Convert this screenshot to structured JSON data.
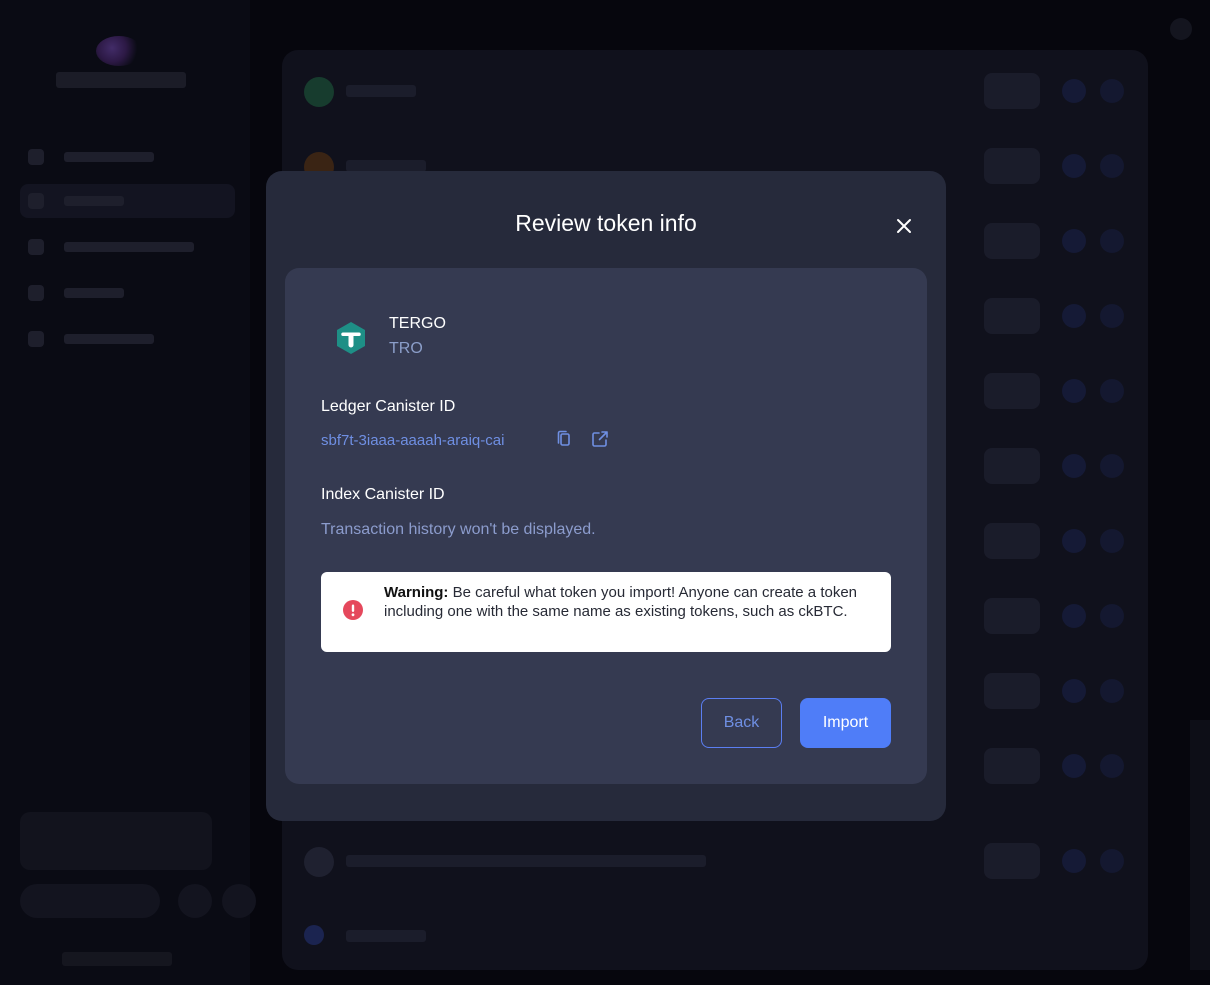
{
  "modal": {
    "title": "Review token info",
    "close_icon": "close-icon"
  },
  "token": {
    "name": "TERGO",
    "symbol": "TRO",
    "logo_icon": "tergo-logo-icon",
    "logo_color": "#1e8f86"
  },
  "ledger": {
    "label": "Ledger Canister ID",
    "value": "sbf7t-3iaaa-aaaah-araiq-cai",
    "copy_icon": "copy-icon",
    "external_icon": "external-link-icon"
  },
  "index": {
    "label": "Index Canister ID",
    "message": "Transaction history won't be displayed."
  },
  "warning": {
    "title": "Warning:",
    "message": " Be careful what token you import! Anyone can create a token including one with the same name as existing tokens, such as ckBTC.",
    "icon": "alert-circle-icon",
    "icon_color": "#e5485c"
  },
  "actions": {
    "back_label": "Back",
    "import_label": "Import"
  },
  "colors": {
    "accent": "#4f7df8",
    "link": "#6f8fe3",
    "modal_bg": "#262a3b",
    "card_bg": "#353a51"
  }
}
